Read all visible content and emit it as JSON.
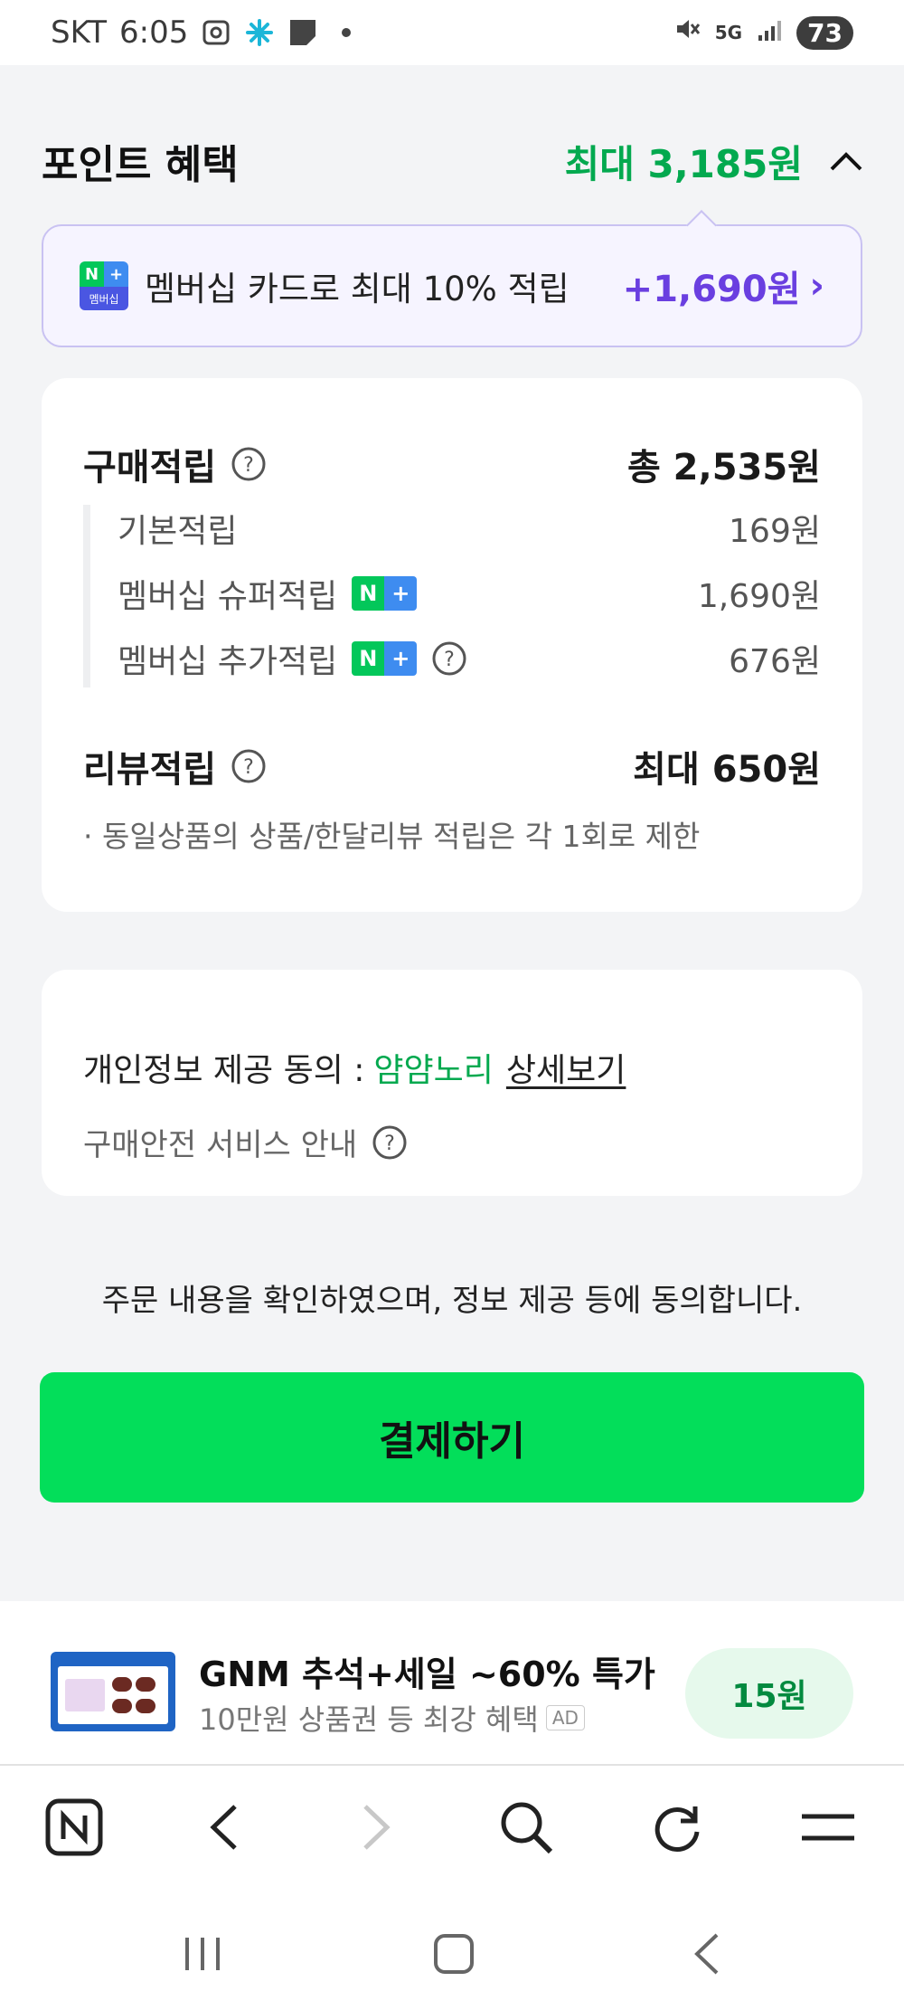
{
  "status_bar": {
    "carrier": "SKT",
    "time": "6:05",
    "network": "5G",
    "battery": "73",
    "icons": [
      "screenshot-icon",
      "sparkle-icon",
      "square-icon",
      "dot-icon",
      "mute-icon",
      "signal-icon"
    ]
  },
  "points": {
    "title": "포인트 혜택",
    "max_label": "최대 3,185원"
  },
  "membership_banner": {
    "logo_n": "N",
    "logo_plus": "+",
    "logo_text": "멤버십",
    "text": "멤버십 카드로 최대 10% 적립",
    "amount": "+1,690원",
    "chevron": "›"
  },
  "purchase_points": {
    "title": "구매적립",
    "total": "총 2,535원",
    "items": [
      {
        "label": "기본적립",
        "value": "169원"
      },
      {
        "label": "멤버십 슈퍼적립",
        "value": "1,690원"
      },
      {
        "label": "멤버십 추가적립",
        "value": "676원"
      }
    ],
    "badge_n": "N",
    "badge_plus": "+"
  },
  "review_points": {
    "title": "리뷰적립",
    "total": "최대 650원",
    "note": "· 동일상품의 상품/한달리뷰 적립은 각 1회로 제한"
  },
  "privacy": {
    "label": "개인정보 제공 동의 :",
    "seller": "얌얌노리",
    "detail_link": "상세보기",
    "safety_label": "구매안전 서비스 안내"
  },
  "agreement_text": "주문 내용을 확인하였으며, 정보 제공 등에 동의합니다.",
  "pay_button": "결제하기",
  "ad": {
    "title": "GNM 추석+세일 ~60% 특가",
    "subtitle": "10만원 상품권 등 최강 혜택",
    "ad_label": "AD",
    "reward": "15원"
  },
  "colors": {
    "accent_green": "#03a94f",
    "pay_green": "#03de5a",
    "membership_purple": "#6a3fe0",
    "background": "#f3f4f6"
  }
}
